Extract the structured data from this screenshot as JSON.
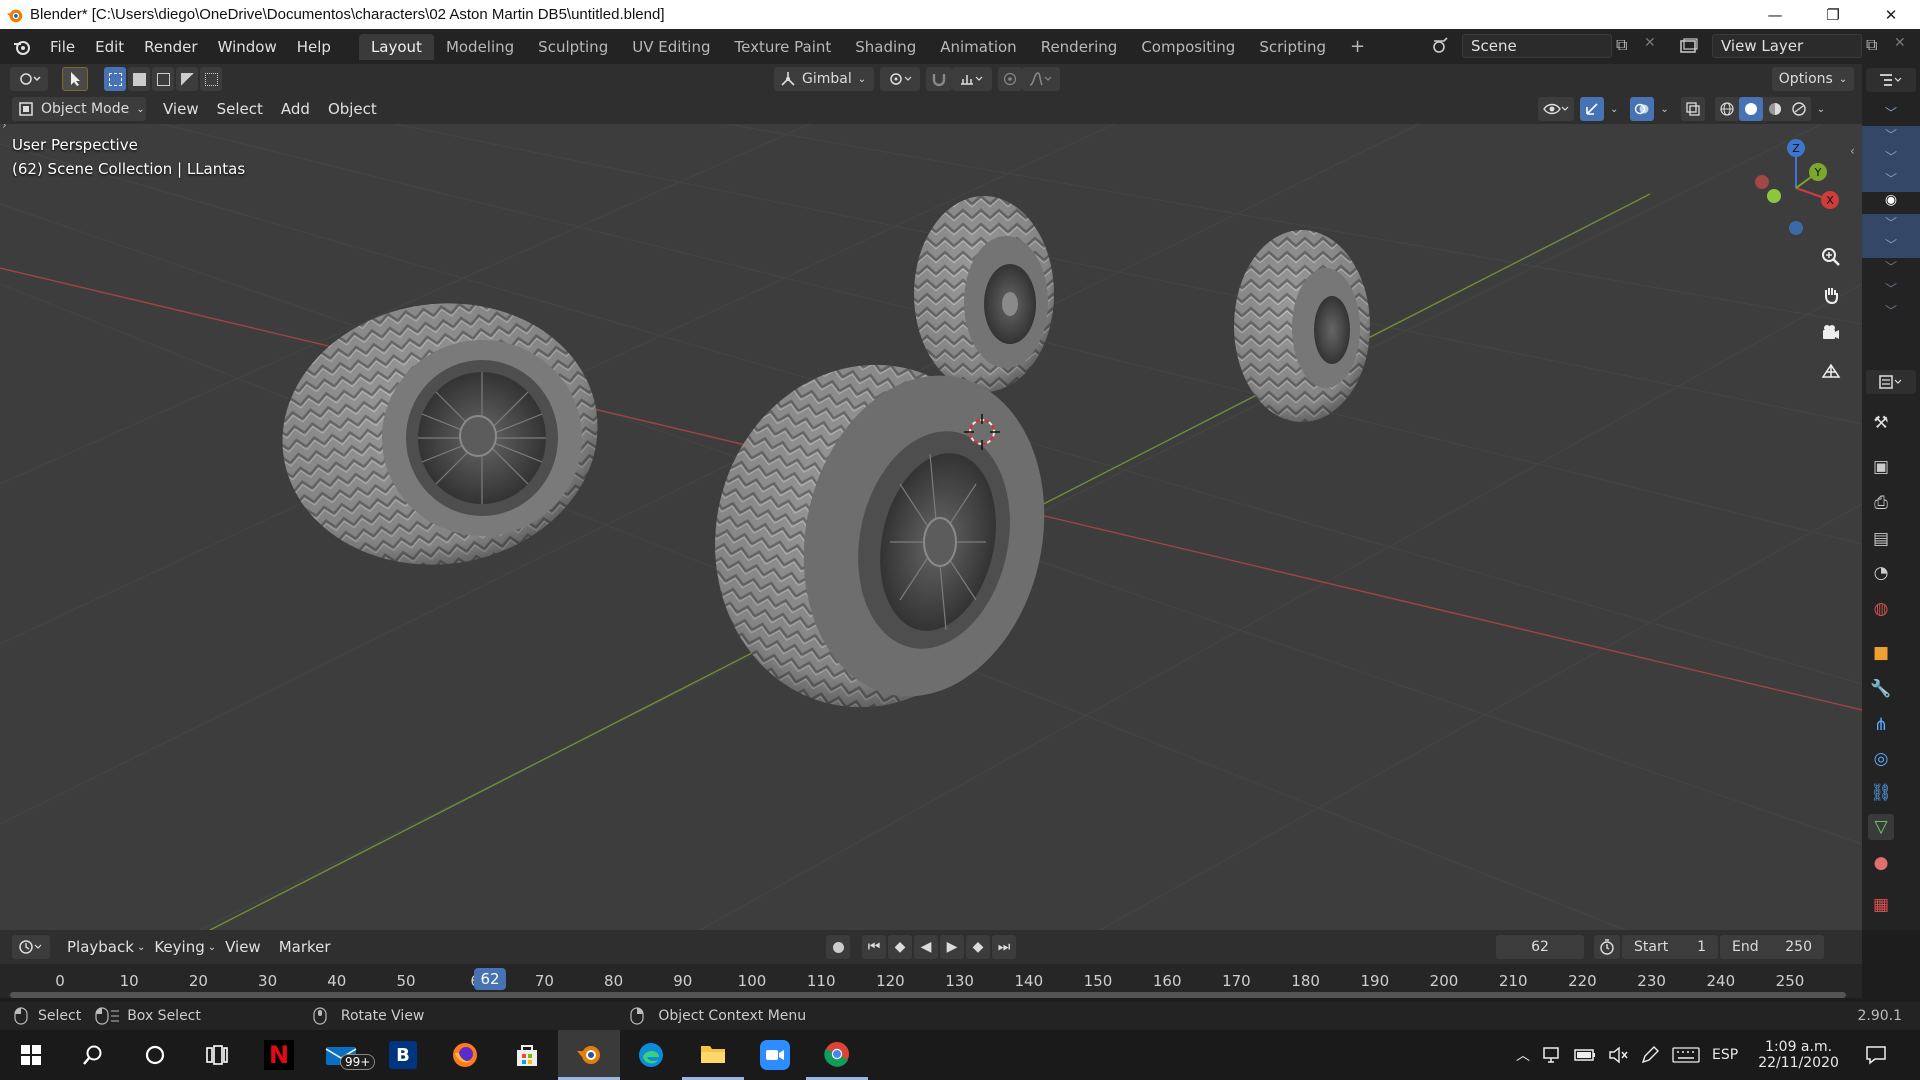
{
  "window": {
    "title": "Blender* [C:\\Users\\diego\\OneDrive\\Documentos\\characters\\02 Aston Martin DB5\\untitled.blend]",
    "minimize": "—",
    "restore": "❐",
    "close": "✕"
  },
  "menu": [
    "File",
    "Edit",
    "Render",
    "Window",
    "Help"
  ],
  "workspaces": [
    "Layout",
    "Modeling",
    "Sculpting",
    "UV Editing",
    "Texture Paint",
    "Shading",
    "Animation",
    "Rendering",
    "Compositing",
    "Scripting"
  ],
  "workspace_add": "+",
  "scene": {
    "name": "Scene",
    "view_layer": "View Layer"
  },
  "toolbar": {
    "orientation": "Gimbal",
    "options": "Options"
  },
  "viewport_header": {
    "mode": "Object Mode",
    "menus": [
      "View",
      "Select",
      "Add",
      "Object"
    ]
  },
  "viewport": {
    "perspective": "User Perspective",
    "collection": "(62) Scene Collection | LLantas",
    "axes": {
      "x": "X",
      "y": "Y",
      "z": "Z"
    }
  },
  "timeline": {
    "menus": [
      "Playback",
      "Keying",
      "View",
      "Marker"
    ],
    "current_frame": "62",
    "start_label": "Start",
    "start": "1",
    "end_label": "End",
    "end": "250",
    "ticks": [
      "0",
      "10",
      "20",
      "30",
      "40",
      "50",
      "6",
      "70",
      "80",
      "90",
      "100",
      "110",
      "120",
      "130",
      "140",
      "150",
      "160",
      "170",
      "180",
      "190",
      "200",
      "210",
      "220",
      "230",
      "240",
      "250"
    ],
    "playhead": "62"
  },
  "status": {
    "select": "Select",
    "box_select": "Box Select",
    "rotate": "Rotate View",
    "context": "Object Context Menu",
    "version": "2.90.1"
  },
  "taskbar": {
    "mail_badge": "99+",
    "lang": "ESP",
    "time": "1:09 a.m.",
    "date": "22/11/2020"
  },
  "colors": {
    "accent": "#4772b3",
    "x_axis": "#c44b4b",
    "y_axis": "#7fa83a",
    "viewport_bg": "#3d3d3d"
  }
}
